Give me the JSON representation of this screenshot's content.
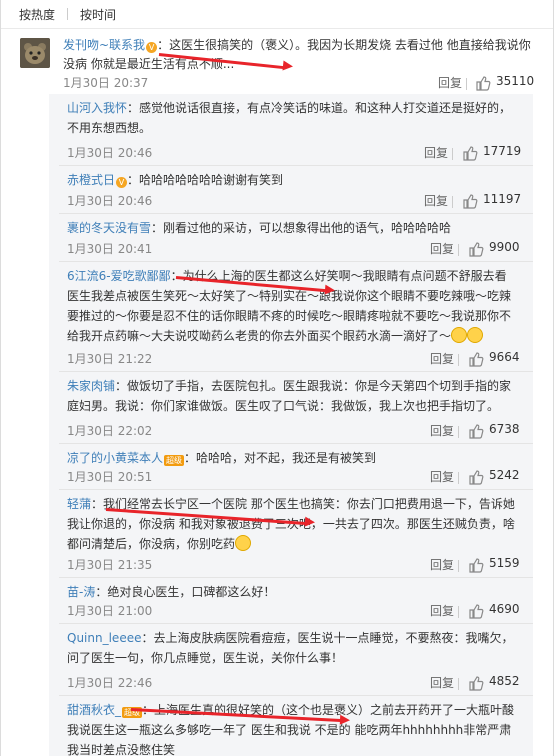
{
  "sort": {
    "hot": "按热度",
    "time": "按时间"
  },
  "main": {
    "user": "发刊吻~联系我",
    "text": "：这医生很搞笑的（褒义）。我因为长期发烧 去看过他 他直接给我说你没病 你就是最近生活有点不顺...",
    "date": "1月30日 20:37",
    "reply": "回复",
    "likes": "35110"
  },
  "subs": [
    {
      "user": "山河入我怀",
      "text": "：感觉他说话很直接，有点冷笑话的味道。和这种人打交道还是挺好的，不用东想西想。",
      "date": "1月30日 20:46",
      "reply": "回复",
      "likes": "17719"
    },
    {
      "user": "赤橙式日",
      "text": "：哈哈哈哈哈哈哈谢谢有笑到",
      "date": "1月30日 20:46",
      "reply": "回复",
      "likes": "11197"
    },
    {
      "user": "裹的冬天没有雪",
      "text": "：刚看过他的采访，可以想象得出他的语气，哈哈哈哈哈",
      "date": "1月30日 20:41",
      "reply": "回复",
      "likes": "9900"
    },
    {
      "user": "6江流6-爱吃歌鄙鄙",
      "text": "：为什么上海的医生都这么好笑啊～我眼睛有点问题不舒服去看医生我差点被医生笑死～太好笑了～特别实在～跟我说你这个眼睛不要吃辣哦～吃辣要推过的～你要是忍不住的话你眼睛不疼的时候吃～眼睛疼啦就不要吃～我说那你不给我开点药嘛～大夫说哎呦药么老贵的你去外面买个眼药水滴一滴好了～",
      "date": "1月30日 21:22",
      "reply": "回复",
      "likes": "9664"
    },
    {
      "user": "朱家肉铺",
      "text": "：做饭切了手指，去医院包扎。医生跟我说：你是今天第四个切到手指的家庭妇男。我说：你们家谁做饭。医生叹了口气说：我做饭，我上次也把手指切了。",
      "date": "1月30日 22:02",
      "reply": "回复",
      "likes": "6738"
    },
    {
      "user": "凉了的小黄菜本人",
      "text": "：哈哈哈，对不起，我还是有被笑到",
      "date": "1月30日 20:51",
      "reply": "回复",
      "likes": "5242"
    },
    {
      "user": "轻蒲",
      "text": "：我们经常去长宁区一个医院 那个医生也搞笑：你去门口把费用退一下，告诉她我让你退的，你没病 和我对象被退费了三次吧，一共去了四次。那医生还贼负责，啥都问清楚后，你没病，你别吃药",
      "date": "1月30日 21:35",
      "reply": "回复",
      "likes": "5159"
    },
    {
      "user": "苗-涛",
      "text": "：绝对良心医生，口碑都这么好！",
      "date": "1月30日 21:00",
      "reply": "回复",
      "likes": "4690"
    },
    {
      "user": "Quinn_leeee",
      "text": "：去上海皮肤病医院看痘痘，医生说十一点睡觉，不要熬夜：我嘴欠，问了医生一句，你几点睡觉，医生说，关你什么事！",
      "date": "1月30日 22:46",
      "reply": "回复",
      "likes": "4852"
    },
    {
      "user": "甜酒秋衣_",
      "text": "：上海医生真的很好笑的（这个也是褒义）之前去开药开了一大瓶叶酸 我说医生这一瓶这么多够吃一年了 医生和我说 不是的 能吃两年hhhhhhhh非常严肃我当时差点没憋住笑",
      "date": "",
      "reply": "",
      "likes": ""
    }
  ],
  "badges": {
    "vip": "V",
    "level": "超级"
  },
  "colors": {
    "username": "#3f7fb8",
    "annotation": "#e8242a",
    "subbg": "#f4f5f7"
  }
}
